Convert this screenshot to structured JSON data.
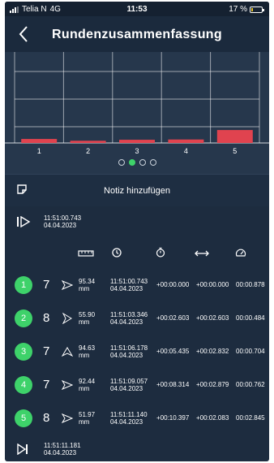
{
  "status_bar": {
    "carrier": "Telia N",
    "network": "4G",
    "time": "11:53",
    "battery_text": "17 %",
    "battery_level": 0.17,
    "battery_color": "#e8c325"
  },
  "header": {
    "title": "Rundenzusammenfassung",
    "back_icon": "chevron-left-icon"
  },
  "chart_data": {
    "type": "bar",
    "categories": [
      "1",
      "2",
      "3",
      "4",
      "5"
    ],
    "values": [
      0.878,
      0.484,
      0.704,
      0.762,
      2.845
    ],
    "ylim": [
      0,
      20
    ],
    "grid": true,
    "bar_color": "#e0434f",
    "title": "",
    "xlabel": "",
    "ylabel": ""
  },
  "pager": {
    "pages": 4,
    "active": 1
  },
  "note": {
    "label": "Notiz hinzufügen",
    "icon": "note-icon"
  },
  "start": {
    "icon": "start-flag-icon",
    "time": "11:51:00.743",
    "date": "04.04.2023"
  },
  "columns": [
    {
      "icon": "ruler-icon"
    },
    {
      "icon": "clock-icon"
    },
    {
      "icon": "stopwatch-icon"
    },
    {
      "icon": "horizontal-arrows-icon"
    },
    {
      "icon": "speedometer-icon"
    }
  ],
  "laps": [
    {
      "number": "1",
      "count": "7",
      "direction_icon": "paper-plane-icon",
      "distance": "95.34",
      "unit": "mm",
      "time": "11:51:00.743",
      "date": "04.04.2023",
      "total": "+00:00.000",
      "split": "+00:00.000",
      "lap_time": "00:00.878"
    },
    {
      "number": "2",
      "count": "8",
      "direction_icon": "arrow-right-icon",
      "distance": "55.90",
      "unit": "mm",
      "time": "11:51:03.346",
      "date": "04.04.2023",
      "total": "+00:02.603",
      "split": "+00:02.603",
      "lap_time": "00:00.484"
    },
    {
      "number": "3",
      "count": "7",
      "direction_icon": "arrow-up-icon",
      "distance": "94.63",
      "unit": "mm",
      "time": "11:51:06.178",
      "date": "04.04.2023",
      "total": "+00:05.435",
      "split": "+00:02.832",
      "lap_time": "00:00.704"
    },
    {
      "number": "4",
      "count": "7",
      "direction_icon": "paper-plane-icon",
      "distance": "92.44",
      "unit": "mm",
      "time": "11:51:09.057",
      "date": "04.04.2023",
      "total": "+00:08.314",
      "split": "+00:02.879",
      "lap_time": "00:00.762"
    },
    {
      "number": "5",
      "count": "8",
      "direction_icon": "paper-plane-icon",
      "distance": "51.97",
      "unit": "mm",
      "time": "11:51:11.140",
      "date": "04.04.2023",
      "total": "+00:10.397",
      "split": "+00:02.083",
      "lap_time": "00:02.845"
    }
  ],
  "end": {
    "icon": "finish-icon",
    "time": "11:51:11.181",
    "date": "04.04.2023"
  }
}
